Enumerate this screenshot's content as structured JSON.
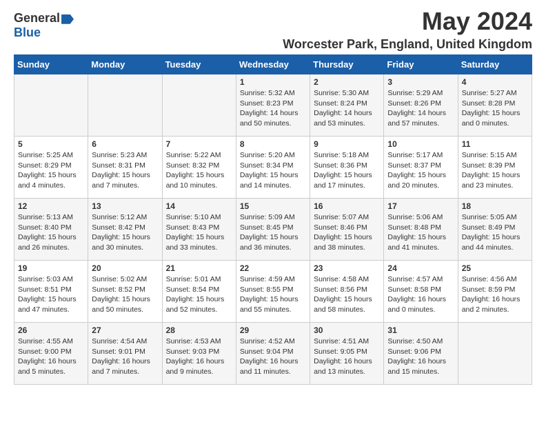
{
  "header": {
    "logo_general": "General",
    "logo_blue": "Blue",
    "month_title": "May 2024",
    "location": "Worcester Park, England, United Kingdom"
  },
  "days_of_week": [
    "Sunday",
    "Monday",
    "Tuesday",
    "Wednesday",
    "Thursday",
    "Friday",
    "Saturday"
  ],
  "weeks": [
    [
      {
        "day": "",
        "info": ""
      },
      {
        "day": "",
        "info": ""
      },
      {
        "day": "",
        "info": ""
      },
      {
        "day": "1",
        "info": "Sunrise: 5:32 AM\nSunset: 8:23 PM\nDaylight: 14 hours\nand 50 minutes."
      },
      {
        "day": "2",
        "info": "Sunrise: 5:30 AM\nSunset: 8:24 PM\nDaylight: 14 hours\nand 53 minutes."
      },
      {
        "day": "3",
        "info": "Sunrise: 5:29 AM\nSunset: 8:26 PM\nDaylight: 14 hours\nand 57 minutes."
      },
      {
        "day": "4",
        "info": "Sunrise: 5:27 AM\nSunset: 8:28 PM\nDaylight: 15 hours\nand 0 minutes."
      }
    ],
    [
      {
        "day": "5",
        "info": "Sunrise: 5:25 AM\nSunset: 8:29 PM\nDaylight: 15 hours\nand 4 minutes."
      },
      {
        "day": "6",
        "info": "Sunrise: 5:23 AM\nSunset: 8:31 PM\nDaylight: 15 hours\nand 7 minutes."
      },
      {
        "day": "7",
        "info": "Sunrise: 5:22 AM\nSunset: 8:32 PM\nDaylight: 15 hours\nand 10 minutes."
      },
      {
        "day": "8",
        "info": "Sunrise: 5:20 AM\nSunset: 8:34 PM\nDaylight: 15 hours\nand 14 minutes."
      },
      {
        "day": "9",
        "info": "Sunrise: 5:18 AM\nSunset: 8:36 PM\nDaylight: 15 hours\nand 17 minutes."
      },
      {
        "day": "10",
        "info": "Sunrise: 5:17 AM\nSunset: 8:37 PM\nDaylight: 15 hours\nand 20 minutes."
      },
      {
        "day": "11",
        "info": "Sunrise: 5:15 AM\nSunset: 8:39 PM\nDaylight: 15 hours\nand 23 minutes."
      }
    ],
    [
      {
        "day": "12",
        "info": "Sunrise: 5:13 AM\nSunset: 8:40 PM\nDaylight: 15 hours\nand 26 minutes."
      },
      {
        "day": "13",
        "info": "Sunrise: 5:12 AM\nSunset: 8:42 PM\nDaylight: 15 hours\nand 30 minutes."
      },
      {
        "day": "14",
        "info": "Sunrise: 5:10 AM\nSunset: 8:43 PM\nDaylight: 15 hours\nand 33 minutes."
      },
      {
        "day": "15",
        "info": "Sunrise: 5:09 AM\nSunset: 8:45 PM\nDaylight: 15 hours\nand 36 minutes."
      },
      {
        "day": "16",
        "info": "Sunrise: 5:07 AM\nSunset: 8:46 PM\nDaylight: 15 hours\nand 38 minutes."
      },
      {
        "day": "17",
        "info": "Sunrise: 5:06 AM\nSunset: 8:48 PM\nDaylight: 15 hours\nand 41 minutes."
      },
      {
        "day": "18",
        "info": "Sunrise: 5:05 AM\nSunset: 8:49 PM\nDaylight: 15 hours\nand 44 minutes."
      }
    ],
    [
      {
        "day": "19",
        "info": "Sunrise: 5:03 AM\nSunset: 8:51 PM\nDaylight: 15 hours\nand 47 minutes."
      },
      {
        "day": "20",
        "info": "Sunrise: 5:02 AM\nSunset: 8:52 PM\nDaylight: 15 hours\nand 50 minutes."
      },
      {
        "day": "21",
        "info": "Sunrise: 5:01 AM\nSunset: 8:54 PM\nDaylight: 15 hours\nand 52 minutes."
      },
      {
        "day": "22",
        "info": "Sunrise: 4:59 AM\nSunset: 8:55 PM\nDaylight: 15 hours\nand 55 minutes."
      },
      {
        "day": "23",
        "info": "Sunrise: 4:58 AM\nSunset: 8:56 PM\nDaylight: 15 hours\nand 58 minutes."
      },
      {
        "day": "24",
        "info": "Sunrise: 4:57 AM\nSunset: 8:58 PM\nDaylight: 16 hours\nand 0 minutes."
      },
      {
        "day": "25",
        "info": "Sunrise: 4:56 AM\nSunset: 8:59 PM\nDaylight: 16 hours\nand 2 minutes."
      }
    ],
    [
      {
        "day": "26",
        "info": "Sunrise: 4:55 AM\nSunset: 9:00 PM\nDaylight: 16 hours\nand 5 minutes."
      },
      {
        "day": "27",
        "info": "Sunrise: 4:54 AM\nSunset: 9:01 PM\nDaylight: 16 hours\nand 7 minutes."
      },
      {
        "day": "28",
        "info": "Sunrise: 4:53 AM\nSunset: 9:03 PM\nDaylight: 16 hours\nand 9 minutes."
      },
      {
        "day": "29",
        "info": "Sunrise: 4:52 AM\nSunset: 9:04 PM\nDaylight: 16 hours\nand 11 minutes."
      },
      {
        "day": "30",
        "info": "Sunrise: 4:51 AM\nSunset: 9:05 PM\nDaylight: 16 hours\nand 13 minutes."
      },
      {
        "day": "31",
        "info": "Sunrise: 4:50 AM\nSunset: 9:06 PM\nDaylight: 16 hours\nand 15 minutes."
      },
      {
        "day": "",
        "info": ""
      }
    ]
  ]
}
